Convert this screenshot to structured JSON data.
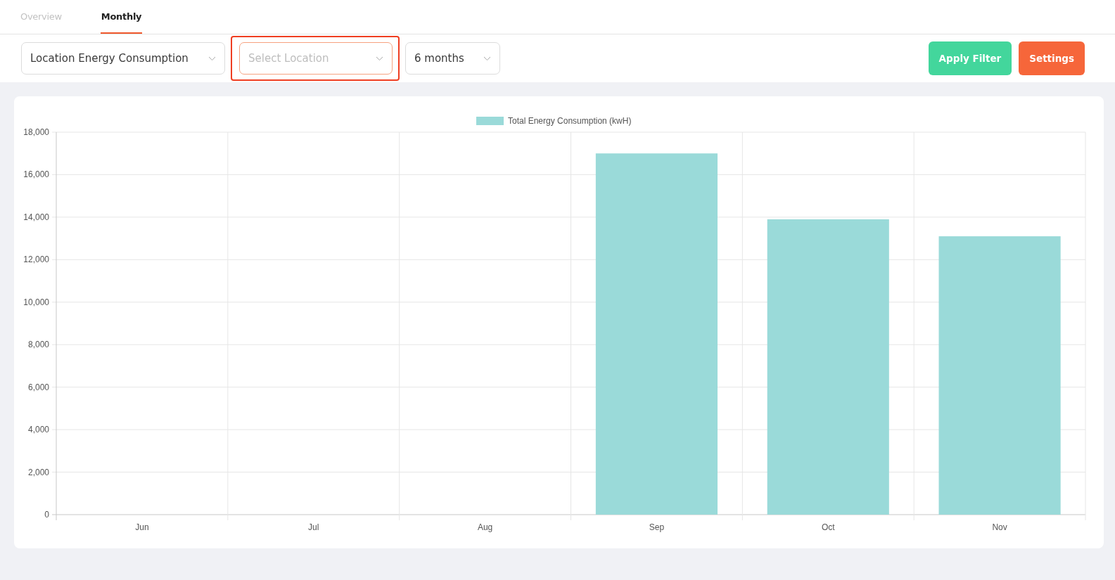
{
  "tabs": [
    {
      "label": "Overview",
      "selected": false
    },
    {
      "label": "Monthly",
      "selected": true
    }
  ],
  "filters": [
    {
      "value": "Location Energy Consumption",
      "focused": false
    },
    {
      "placeholder": "Select Location",
      "focused": true
    },
    {
      "value": "6 months",
      "focused": false
    }
  ],
  "buttons": [
    {
      "label": "Apply Filter",
      "kind": "primary"
    },
    {
      "label": "Settings",
      "kind": "accent"
    }
  ],
  "chart_data": {
    "type": "bar",
    "categories": [
      "Jun",
      "Jul",
      "Aug",
      "Sep",
      "Oct",
      "Nov"
    ],
    "series": [
      {
        "name": "Total Energy Consumption (kwH)",
        "color": "#9adad9",
        "values": [
          0,
          0,
          0,
          17000,
          13900,
          13100
        ]
      }
    ],
    "ylim": [
      0,
      18000
    ],
    "grid": true,
    "yticks": [
      {
        "value": 0,
        "label": "0"
      },
      {
        "value": 2000,
        "label": "2,000"
      },
      {
        "value": 4000,
        "label": "4,000"
      },
      {
        "value": 6000,
        "label": "6,000"
      },
      {
        "value": 8000,
        "label": "8,000"
      },
      {
        "value": 10000,
        "label": "10,000"
      },
      {
        "value": 12000,
        "label": "12,000"
      },
      {
        "value": 14000,
        "label": "14,000"
      },
      {
        "value": 16000,
        "label": "16,000"
      },
      {
        "value": 18000,
        "label": "18,000"
      }
    ]
  }
}
